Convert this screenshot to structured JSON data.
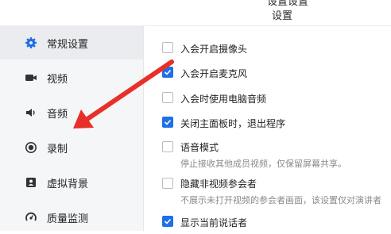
{
  "window": {
    "title_clipped": "设置设置",
    "title": "设置"
  },
  "sidebar": {
    "items": [
      {
        "label": "常规设置",
        "icon": "gear-icon",
        "active": true
      },
      {
        "label": "视频",
        "icon": "video-camera-icon",
        "active": false
      },
      {
        "label": "音频",
        "icon": "speaker-icon",
        "active": false
      },
      {
        "label": "录制",
        "icon": "record-icon",
        "active": false
      },
      {
        "label": "虚拟背景",
        "icon": "person-background-icon",
        "active": false
      },
      {
        "label": "质量监测",
        "icon": "gauge-icon",
        "active": false
      }
    ]
  },
  "options": [
    {
      "label": "入会开启摄像头",
      "checked": false
    },
    {
      "label": "入会开启麦克风",
      "checked": true
    },
    {
      "label": "入会时使用电脑音频",
      "checked": false
    },
    {
      "label": "关闭主面板时，退出程序",
      "checked": true
    },
    {
      "label": "语音模式",
      "checked": false,
      "desc": "停止接收其他成员视频，仅保留屏幕共享。"
    },
    {
      "label": "隐藏非视频参会者",
      "checked": false,
      "desc": "不展示未打开视频的参会者画面，该设置仅对演讲者"
    },
    {
      "label": "显示当前说话者",
      "checked": true
    }
  ],
  "colors": {
    "accent": "#1e6fe8",
    "annotation_arrow": "#e8302a"
  }
}
